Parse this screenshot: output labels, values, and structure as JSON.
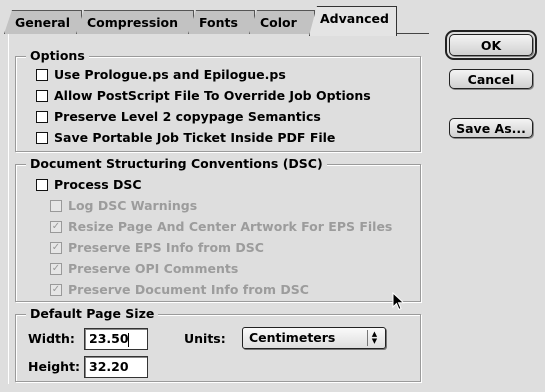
{
  "tabs": [
    {
      "label": "General"
    },
    {
      "label": "Compression"
    },
    {
      "label": "Fonts"
    },
    {
      "label": "Color"
    },
    {
      "label": "Advanced",
      "active": true
    }
  ],
  "buttons": {
    "ok": "OK",
    "cancel": "Cancel",
    "save_as": "Save As..."
  },
  "options": {
    "title": "Options",
    "items": [
      {
        "label": "Use Prologue.ps and Epilogue.ps",
        "checked": false
      },
      {
        "label": "Allow PostScript File To Override Job Options",
        "checked": false
      },
      {
        "label": "Preserve Level 2 copypage Semantics",
        "checked": false
      },
      {
        "label": "Save Portable Job Ticket Inside PDF File",
        "checked": false
      }
    ]
  },
  "dsc": {
    "title": "Document Structuring Conventions (DSC)",
    "process": {
      "label": "Process DSC",
      "checked": false
    },
    "sub_items": [
      {
        "label": "Log DSC Warnings",
        "checked": false,
        "enabled": false
      },
      {
        "label": "Resize Page And Center Artwork For EPS Files",
        "checked": true,
        "enabled": false
      },
      {
        "label": "Preserve EPS Info from DSC",
        "checked": true,
        "enabled": false
      },
      {
        "label": "Preserve OPI Comments",
        "checked": true,
        "enabled": false
      },
      {
        "label": "Preserve Document Info from DSC",
        "checked": true,
        "enabled": false
      }
    ]
  },
  "page_size": {
    "title": "Default Page Size",
    "width_label": "Width:",
    "width_value": "23.50",
    "height_label": "Height:",
    "height_value": "32.20",
    "units_label": "Units:",
    "units_value": "Centimeters"
  },
  "icons": {
    "check": "✓",
    "arrow_up": "▲",
    "arrow_down": "▼"
  }
}
